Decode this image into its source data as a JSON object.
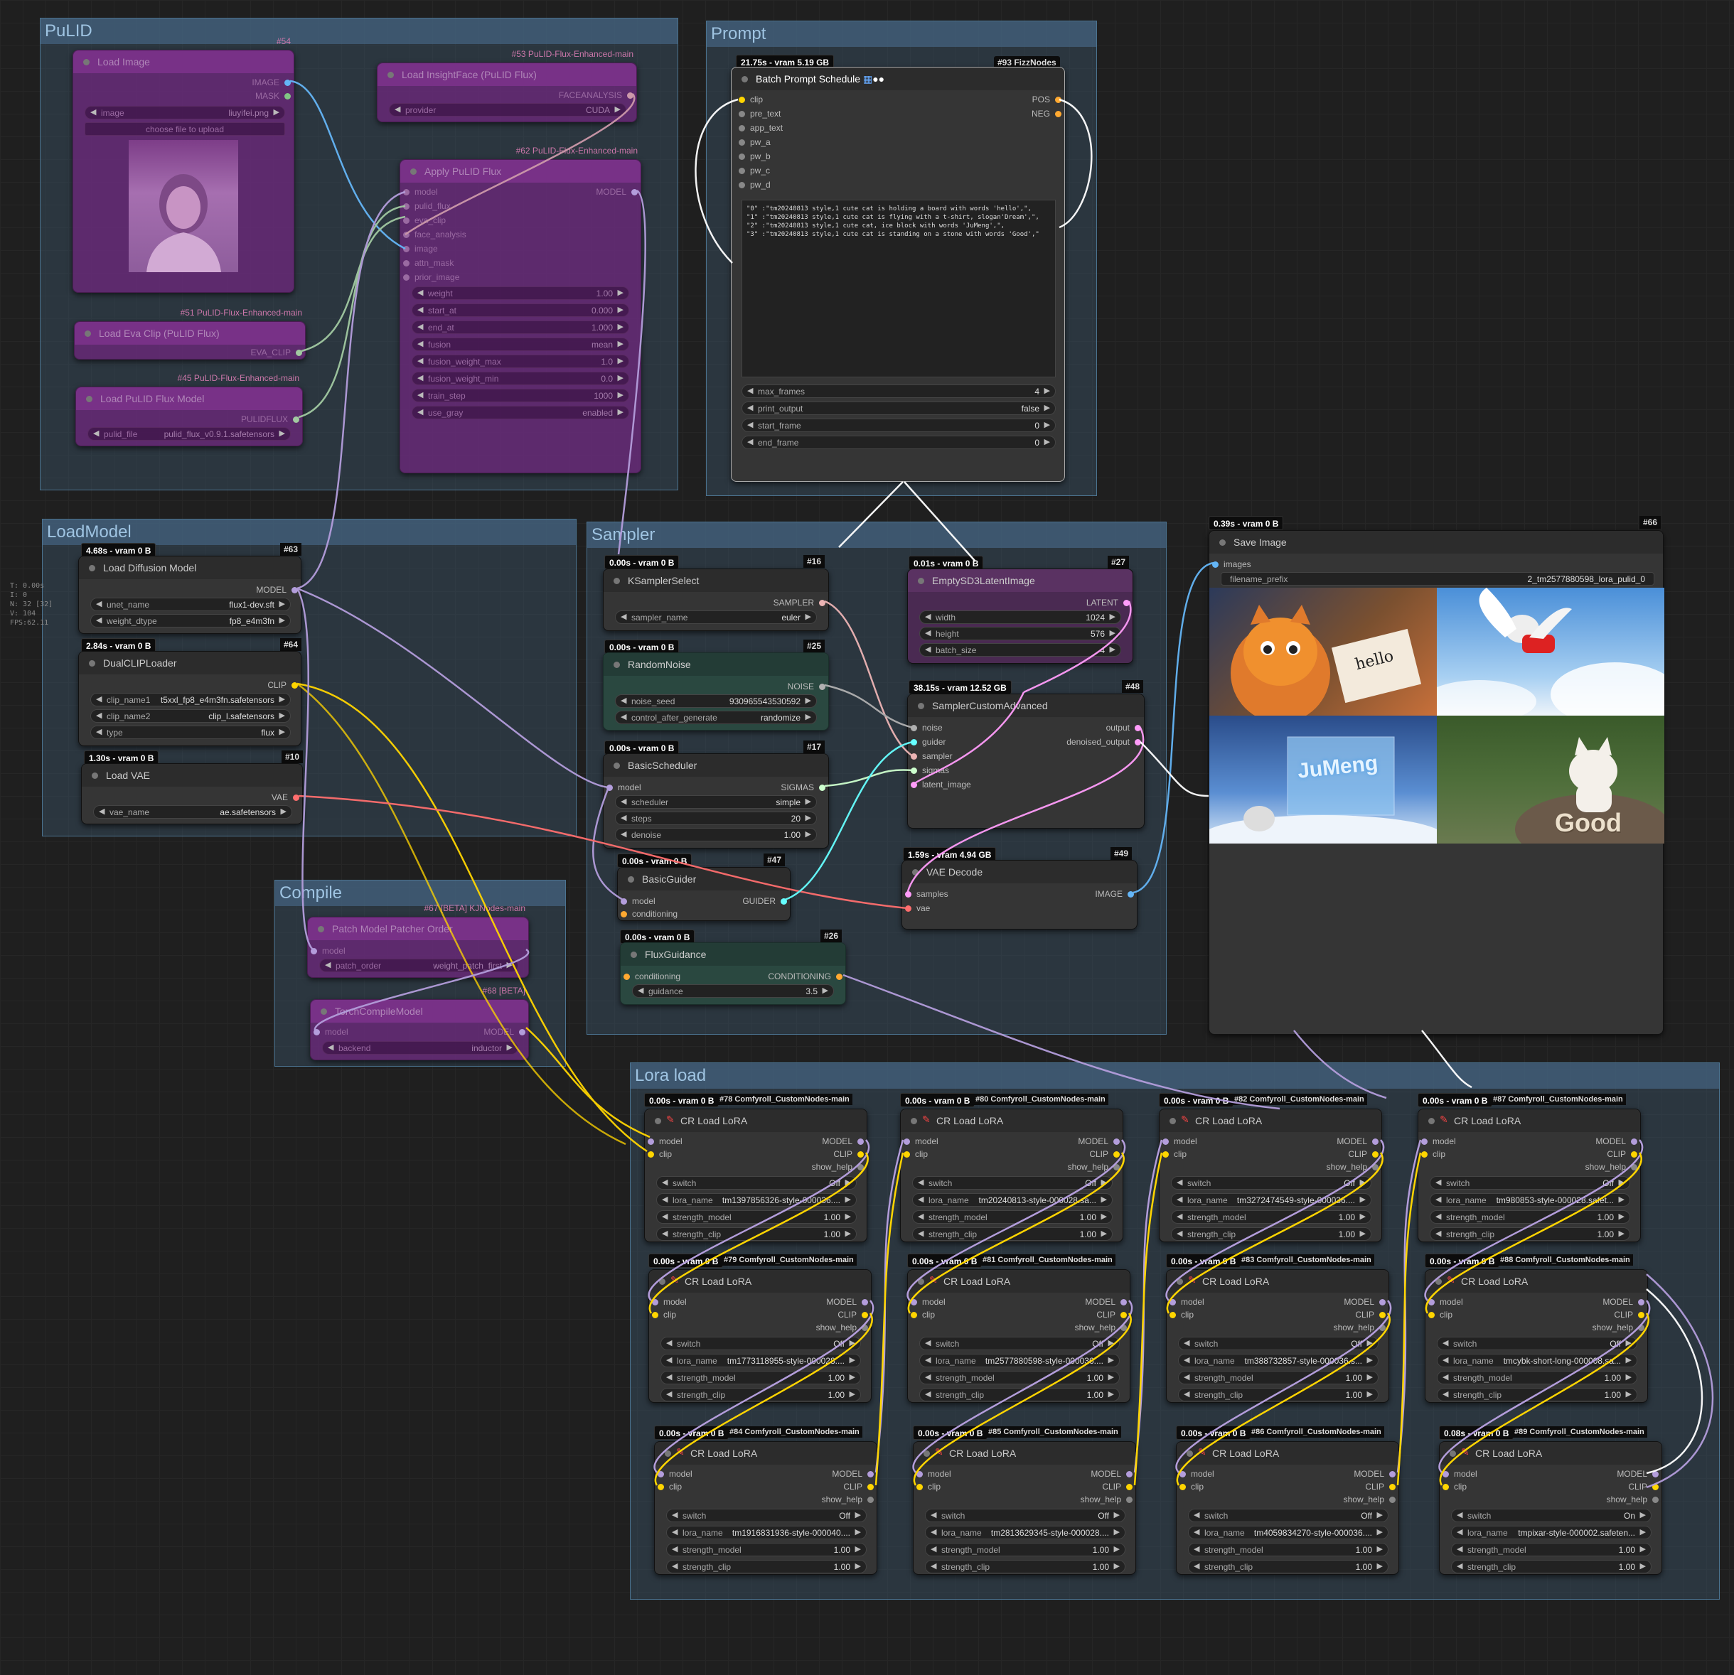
{
  "stats": [
    "T: 0.00s",
    "I: 0",
    "N: 32 [32]",
    "V: 104",
    "FPS:62.11"
  ],
  "groups": {
    "pulid": "PuLID",
    "prompt": "Prompt",
    "loadmodel": "LoadModel",
    "sampler": "Sampler",
    "compile": "Compile",
    "lora": "Lora load"
  },
  "nodes": {
    "load_image": {
      "title": "Load Image",
      "id": "#54",
      "out1": "IMAGE",
      "out2": "MASK",
      "w1_label": "image",
      "w1_value": "liuyifei.png",
      "upload": "choose file to upload"
    },
    "insightface": {
      "title": "Load InsightFace (PuLID Flux)",
      "id": "#53 PuLID-Flux-Enhanced-main",
      "out": "FACEANALYSIS",
      "w_label": "provider",
      "w_value": "CUDA"
    },
    "apply_pulid": {
      "title": "Apply PuLID Flux",
      "id": "#62 PuLID-Flux-Enhanced-main",
      "inputs": [
        "model",
        "pulid_flux",
        "eva_clip",
        "face_analysis",
        "image",
        "attn_mask",
        "prior_image"
      ],
      "out": "MODEL",
      "widgets": [
        [
          "weight",
          "1.00"
        ],
        [
          "start_at",
          "0.000"
        ],
        [
          "end_at",
          "1.000"
        ],
        [
          "fusion",
          "mean"
        ],
        [
          "fusion_weight_max",
          "1.0"
        ],
        [
          "fusion_weight_min",
          "0.0"
        ],
        [
          "train_step",
          "1000"
        ],
        [
          "use_gray",
          "enabled"
        ]
      ]
    },
    "eva_clip": {
      "title": "Load Eva Clip (PuLID Flux)",
      "id": "#51 PuLID-Flux-Enhanced-main",
      "out": "EVA_CLIP"
    },
    "pulid_model": {
      "title": "Load PuLID Flux Model",
      "id": "#45 PuLID-Flux-Enhanced-main",
      "out": "PULIDFLUX",
      "w_label": "pulid_file",
      "w_value": "pulid_flux_v0.9.1.safetensors"
    },
    "batch_prompt": {
      "title": "Batch Prompt Schedule",
      "badge": "21.75s - vram 5.19 GB",
      "id": "#93 FizzNodes",
      "inputs": [
        "clip",
        "pre_text",
        "app_text",
        "pw_a",
        "pw_b",
        "pw_c",
        "pw_d"
      ],
      "out1": "POS",
      "out2": "NEG",
      "text": "\"0\" :\"tm20240813 style,1 cute cat is holding a board with words 'hello',\",\n\"1\" :\"tm20240813 style,1 cute cat is flying with a t-shirt, slogan'Dream',\",\n\"2\" :\"tm20240813 style,1 cute cat, ice block with words 'JuMeng',\",\n\"3\" :\"tm20240813 style,1 cute cat is standing on a stone with words 'Good',\"",
      "widgets": [
        [
          "max_frames",
          "4"
        ],
        [
          "print_output",
          "false"
        ],
        [
          "start_frame",
          "0"
        ],
        [
          "end_frame",
          "0"
        ]
      ]
    },
    "diffusion": {
      "title": "Load Diffusion Model",
      "badge": "4.68s - vram 0 B",
      "id": "#63",
      "out": "MODEL",
      "widgets": [
        [
          "unet_name",
          "flux1-dev.sft"
        ],
        [
          "weight_dtype",
          "fp8_e4m3fn"
        ]
      ]
    },
    "dualclip": {
      "title": "DualCLIPLoader",
      "badge": "2.84s - vram 0 B",
      "id": "#64",
      "out": "CLIP",
      "widgets": [
        [
          "clip_name1",
          "t5xxl_fp8_e4m3fn.safetensors"
        ],
        [
          "clip_name2",
          "clip_l.safetensors"
        ],
        [
          "type",
          "flux"
        ]
      ]
    },
    "vae": {
      "title": "Load VAE",
      "badge": "1.30s - vram 0 B",
      "id": "#10",
      "out": "VAE",
      "widgets": [
        [
          "vae_name",
          "ae.safetensors"
        ]
      ]
    },
    "patch": {
      "title": "Patch Model Patcher Order",
      "id": "#67 [BETA] KJNodes-main",
      "in": "model",
      "w_label": "patch_order",
      "w_value": "weight_patch_first"
    },
    "torch_compile": {
      "title": "TorchCompileModel",
      "id": "#68 [BETA]",
      "in": "model",
      "out": "MODEL",
      "w_label": "backend",
      "w_value": "inductor"
    },
    "ksampler_select": {
      "title": "KSamplerSelect",
      "badge": "0.00s - vram 0 B",
      "id": "#16",
      "out": "SAMPLER",
      "widgets": [
        [
          "sampler_name",
          "euler"
        ]
      ]
    },
    "random_noise": {
      "title": "RandomNoise",
      "badge": "0.00s - vram 0 B",
      "id": "#25",
      "out": "NOISE",
      "widgets": [
        [
          "noise_seed",
          "930965543530592"
        ],
        [
          "control_after_generate",
          "randomize"
        ]
      ]
    },
    "basic_scheduler": {
      "title": "BasicScheduler",
      "badge": "0.00s - vram 0 B",
      "id": "#17",
      "in": "model",
      "out": "SIGMAS",
      "widgets": [
        [
          "scheduler",
          "simple"
        ],
        [
          "steps",
          "20"
        ],
        [
          "denoise",
          "1.00"
        ]
      ]
    },
    "basic_guider": {
      "title": "BasicGuider",
      "badge": "0.00s - vram 0 B",
      "id": "#47",
      "in1": "model",
      "in2": "conditioning",
      "out": "GUIDER"
    },
    "flux_guidance": {
      "title": "FluxGuidance",
      "badge": "0.00s - vram 0 B",
      "id": "#26",
      "in": "conditioning",
      "out": "CONDITIONING",
      "widgets": [
        [
          "guidance",
          "3.5"
        ]
      ]
    },
    "empty_latent": {
      "title": "EmptySD3LatentImage",
      "badge": "0.01s - vram 0 B",
      "id": "#27",
      "out": "LATENT",
      "widgets": [
        [
          "width",
          "1024"
        ],
        [
          "height",
          "576"
        ],
        [
          "batch_size",
          "4"
        ]
      ]
    },
    "sampler_adv": {
      "title": "SamplerCustomAdvanced",
      "badge": "38.15s - vram 12.52 GB",
      "id": "#48",
      "inputs": [
        "noise",
        "guider",
        "sampler",
        "sigmas",
        "latent_image"
      ],
      "out1": "output",
      "out2": "denoised_output"
    },
    "vae_decode": {
      "title": "VAE Decode",
      "badge": "1.59s - vram 4.94 GB",
      "id": "#49",
      "in1": "samples",
      "in2": "vae",
      "out": "IMAGE"
    },
    "save_image": {
      "title": "Save Image",
      "badge": "0.39s - vram 0 B",
      "id": "#66",
      "in": "images",
      "w_label": "filename_prefix",
      "w_value": "2_tm2577880598_lora_pulid_0"
    }
  },
  "image_text": {
    "hello": "hello",
    "jumeng": "JuMeng",
    "good": "Good"
  },
  "lora_common": {
    "title": "CR Load LoRA",
    "in1": "model",
    "in2": "clip",
    "out1": "MODEL",
    "out2": "CLIP",
    "out3": "show_help",
    "w_switch": "switch",
    "w_lora": "lora_name",
    "w_sm": "strength_model",
    "w_sc": "strength_clip"
  },
  "loras": [
    {
      "badge": "0.00s - vram 0 B",
      "id": "#78 Comfyroll_CustomNodes-main",
      "switch": "Off",
      "lora_name": "tm1397856326-style-000036....",
      "sm": "1.00",
      "sc": "1.00"
    },
    {
      "badge": "0.00s - vram 0 B",
      "id": "#80 Comfyroll_CustomNodes-main",
      "switch": "Off",
      "lora_name": "tm20240813-style-000028.sa...",
      "sm": "1.00",
      "sc": "1.00"
    },
    {
      "badge": "0.00s - vram 0 B",
      "id": "#82 Comfyroll_CustomNodes-main",
      "switch": "Off",
      "lora_name": "tm3272474549-style-000036....",
      "sm": "1.00",
      "sc": "1.00"
    },
    {
      "badge": "0.00s - vram 0 B",
      "id": "#87 Comfyroll_CustomNodes-main",
      "switch": "Off",
      "lora_name": "tm980853-style-000028.safet...",
      "sm": "1.00",
      "sc": "1.00"
    },
    {
      "badge": "0.00s - vram 0 B",
      "id": "#79 Comfyroll_CustomNodes-main",
      "switch": "Off",
      "lora_name": "tm1773118955-style-000028....",
      "sm": "1.00",
      "sc": "1.00"
    },
    {
      "badge": "0.00s - vram 0 B",
      "id": "#81 Comfyroll_CustomNodes-main",
      "switch": "Off",
      "lora_name": "tm2577880598-style-000036....",
      "sm": "1.00",
      "sc": "1.00"
    },
    {
      "badge": "0.00s - vram 0 B",
      "id": "#83 Comfyroll_CustomNodes-main",
      "switch": "Off",
      "lora_name": "tm388732857-style-000036.s...",
      "sm": "1.00",
      "sc": "1.00"
    },
    {
      "badge": "0.00s - vram 0 B",
      "id": "#88 Comfyroll_CustomNodes-main",
      "switch": "Off",
      "lora_name": "tmcybk-short-long-000008.sa...",
      "sm": "1.00",
      "sc": "1.00"
    },
    {
      "badge": "0.00s - vram 0 B",
      "id": "#84 Comfyroll_CustomNodes-main",
      "switch": "Off",
      "lora_name": "tm1916831936-style-000040....",
      "sm": "1.00",
      "sc": "1.00"
    },
    {
      "badge": "0.00s - vram 0 B",
      "id": "#85 Comfyroll_CustomNodes-main",
      "switch": "Off",
      "lora_name": "tm2813629345-style-000028....",
      "sm": "1.00",
      "sc": "1.00"
    },
    {
      "badge": "0.00s - vram 0 B",
      "id": "#86 Comfyroll_CustomNodes-main",
      "switch": "Off",
      "lora_name": "tm4059834270-style-000036....",
      "sm": "1.00",
      "sc": "1.00"
    },
    {
      "badge": "0.08s - vram 0 B",
      "id": "#89 Comfyroll_CustomNodes-main",
      "switch": "On",
      "lora_name": "tmpixar-style-000002.safeten...",
      "sm": "1.00",
      "sc": "1.00"
    }
  ],
  "colors": {
    "model": "#b39ddb",
    "clip": "#ffd500",
    "vae": "#ff6e6e",
    "image": "#64b5f6",
    "conditioning": "#ffa931",
    "latent": "#ff9cf9",
    "noise": "#b0b0b0",
    "guider": "#66ffff",
    "sigmas": "#cdffcd",
    "eva": "#a1c9a1"
  }
}
